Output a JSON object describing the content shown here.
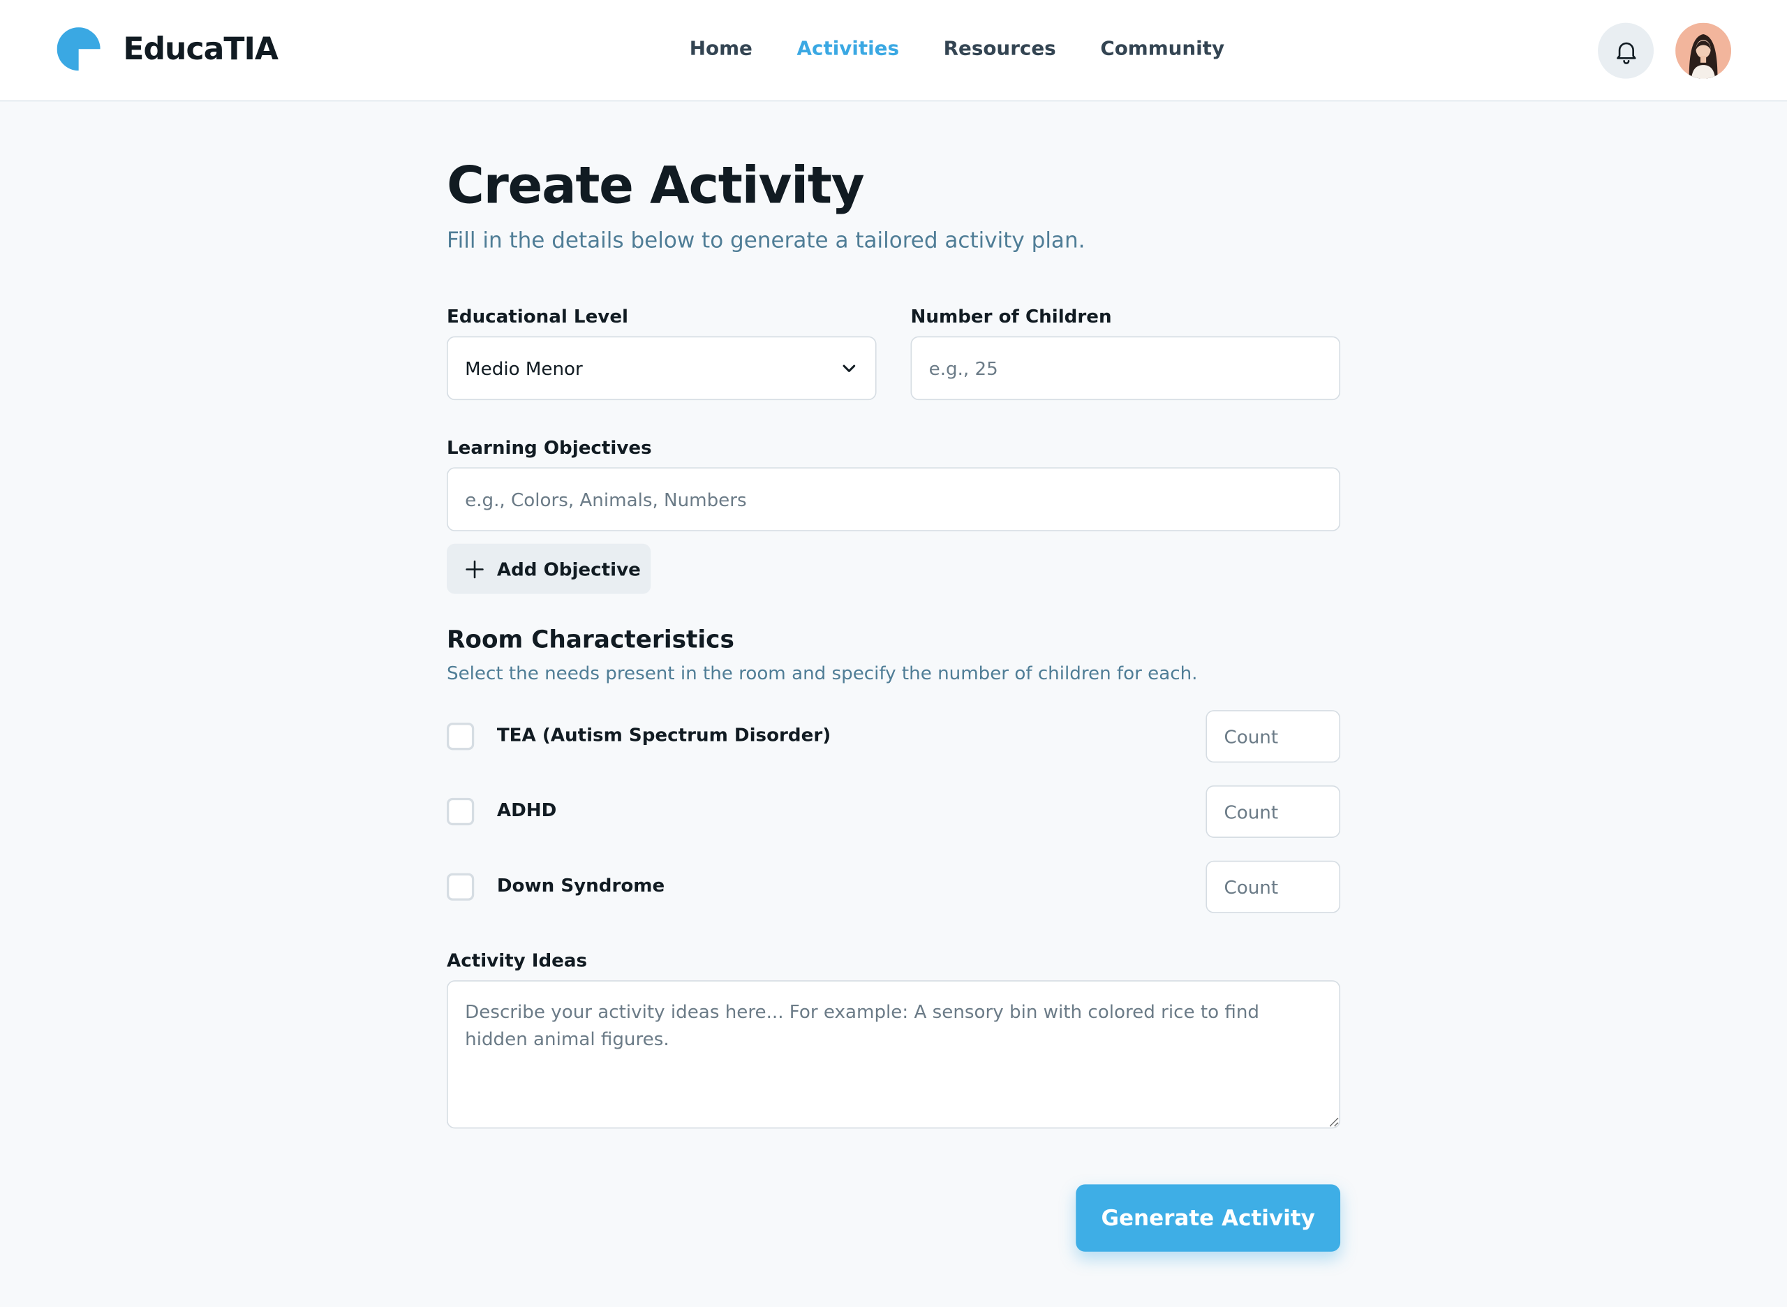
{
  "app": {
    "brand_name": "EducaTIA",
    "accent_color": "#3aa8e3"
  },
  "nav": {
    "items": [
      {
        "label": "Home",
        "active": false
      },
      {
        "label": "Activities",
        "active": true
      },
      {
        "label": "Resources",
        "active": false
      },
      {
        "label": "Community",
        "active": false
      }
    ]
  },
  "header_icons": {
    "notifications": "bell-icon",
    "profile": "avatar"
  },
  "page": {
    "title": "Create Activity",
    "subtitle": "Fill in the details below to generate a tailored activity plan."
  },
  "form": {
    "educational_level": {
      "label": "Educational Level",
      "value": "Medio Menor"
    },
    "number_of_children": {
      "label": "Number of Children",
      "placeholder": "e.g., 25"
    },
    "learning_objectives": {
      "label": "Learning Objectives",
      "placeholder": "e.g., Colors, Animals, Numbers"
    },
    "add_objective_label": "Add Objective",
    "room": {
      "title": "Room Characteristics",
      "subtitle": "Select the needs present in the room and specify the number of children for each.",
      "needs": [
        {
          "label": "TEA (Autism Spectrum Disorder)",
          "checked": false,
          "count_placeholder": "Count"
        },
        {
          "label": "ADHD",
          "checked": false,
          "count_placeholder": "Count"
        },
        {
          "label": "Down Syndrome",
          "checked": false,
          "count_placeholder": "Count"
        }
      ]
    },
    "activity_ideas": {
      "label": "Activity Ideas",
      "placeholder": "Describe your activity ideas here... For example: A sensory bin with colored rice to find hidden animal figures."
    },
    "submit_label": "Generate Activity"
  }
}
